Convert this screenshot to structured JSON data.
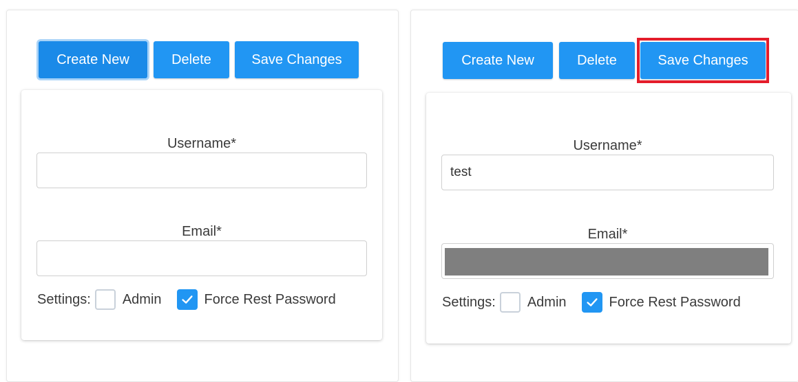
{
  "left_panel": {
    "buttons": {
      "create": "Create New",
      "delete": "Delete",
      "save": "Save Changes"
    },
    "username": {
      "label": "Username*",
      "value": ""
    },
    "email": {
      "label": "Email*",
      "value": ""
    },
    "settings": {
      "label": "Settings:",
      "admin": {
        "label": "Admin",
        "checked": false
      },
      "force_reset": {
        "label": "Force Rest Password",
        "checked": true
      }
    }
  },
  "right_panel": {
    "buttons": {
      "create": "Create New",
      "delete": "Delete",
      "save": "Save Changes"
    },
    "username": {
      "label": "Username*",
      "value": "test"
    },
    "email": {
      "label": "Email*",
      "value": ""
    },
    "settings": {
      "label": "Settings:",
      "admin": {
        "label": "Admin",
        "checked": false
      },
      "force_reset": {
        "label": "Force Rest Password",
        "checked": true
      }
    }
  },
  "colors": {
    "primary": "#2196f3",
    "highlight": "#e41d2b",
    "redaction": "#7f7f7f"
  }
}
